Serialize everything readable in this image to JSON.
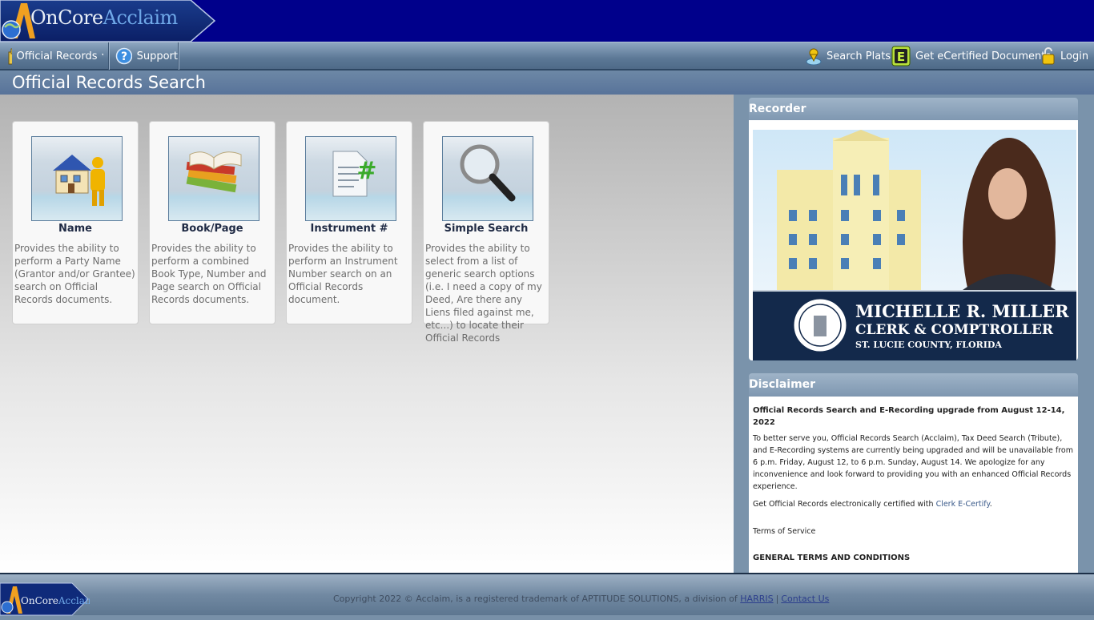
{
  "header": {
    "logo_part1": "OnCore",
    "logo_part2": "Acclaim"
  },
  "nav": {
    "official_records": "Official Records",
    "support": "Support",
    "search_plats": "Search Plats",
    "ecertified": "Get eCertified Documents",
    "login": "Login"
  },
  "page": {
    "title": "Official Records Search"
  },
  "cards": [
    {
      "title": "Name",
      "desc": "Provides the ability to perform a Party Name (Grantor and/or Grantee) search on Official Records documents."
    },
    {
      "title": "Book/Page",
      "desc": "Provides the ability to perform a combined Book Type, Number and Page search on Official Records documents."
    },
    {
      "title": "Instrument #",
      "desc": "Provides the ability to perform an Instrument Number search on an Official Records document."
    },
    {
      "title": "Simple Search",
      "desc": "Provides the ability to select from a list of generic search options (i.e. I need a copy of my Deed, Are there any Liens filed against me, etc...) to locate their Official Records"
    }
  ],
  "sidebar": {
    "recorder_title": "Recorder",
    "banner_name": "MICHELLE R. MILLER",
    "banner_role": "CLERK & COMPTROLLER",
    "banner_county": "ST. LUCIE COUNTY, FLORIDA",
    "disclaimer_title": "Disclaimer",
    "disclaimer_heading": "Official Records Search and E-Recording upgrade from August 12-14, 2022",
    "disclaimer_body": "To better serve you, Official Records Search (Acclaim), Tax Deed Search (Tribute), and E-Recording systems are currently being upgraded and will be unavailable from 6 p.m. Friday, August 12, to 6 p.m. Sunday, August 14. We apologize for any inconvenience and look forward to providing you with an enhanced Official Records experience.",
    "ecertify_prefix": "Get Official Records electronically certified with ",
    "ecertify_link": "Clerk E-Certify",
    "ecertify_suffix": ".",
    "tos": "Terms of Service",
    "terms_heading": "GENERAL TERMS AND CONDITIONS"
  },
  "footer": {
    "logo_part1": "OnCore",
    "logo_part2": "Acclaim",
    "copyright": "Copyright 2022 © Acclaim, is a registered trademark of APTITUDE SOLUTIONS, a division of ",
    "harris_link": "HARRIS",
    "pipe": "|",
    "contact_link": "Contact Us"
  },
  "colors": {
    "header_bg": "#00008b",
    "nav_bg": "#5c7896",
    "sidebar_bg": "#7a93ab",
    "banner_navy": "#13294b"
  }
}
